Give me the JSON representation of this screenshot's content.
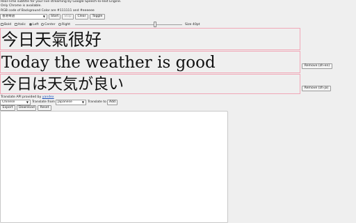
{
  "info": {
    "line1": "Real-Time subtitle for your live streaming by Google Speech-To-Text Engine.",
    "line2": "Only Chrome is available.",
    "line3": "RGB code of Background Color are #111111 and #eeeeee"
  },
  "controls": {
    "language_select": "香港粵語",
    "start": "Start",
    "stop": "Stop",
    "clear": "Clear",
    "toggle": "Toggle"
  },
  "formatting": {
    "bold": "Bold",
    "italic": "Italic",
    "left": "Left",
    "center": "Center",
    "right": "Right",
    "size_label": "Size 40pt",
    "size_value": 40,
    "selected_align": "Left"
  },
  "subtitles": [
    {
      "text": "今日天氣很好",
      "remove": ""
    },
    {
      "text": "Today the weather is good",
      "remove": "Remove (zh-en)"
    },
    {
      "text": "今日は天気が良い",
      "remove": "Remove (zh-ja)"
    }
  ],
  "translate": {
    "api_prefix": "Translate API provided by",
    "api_link": "yandex",
    "target_select": "Chinese",
    "from_label": "Translate from",
    "from_select": "Japanese",
    "to_label": "Translate to",
    "add": "Add"
  },
  "actions": {
    "export": "Export",
    "download": "Download",
    "reset": "Reset"
  },
  "textarea": {
    "value": ""
  }
}
